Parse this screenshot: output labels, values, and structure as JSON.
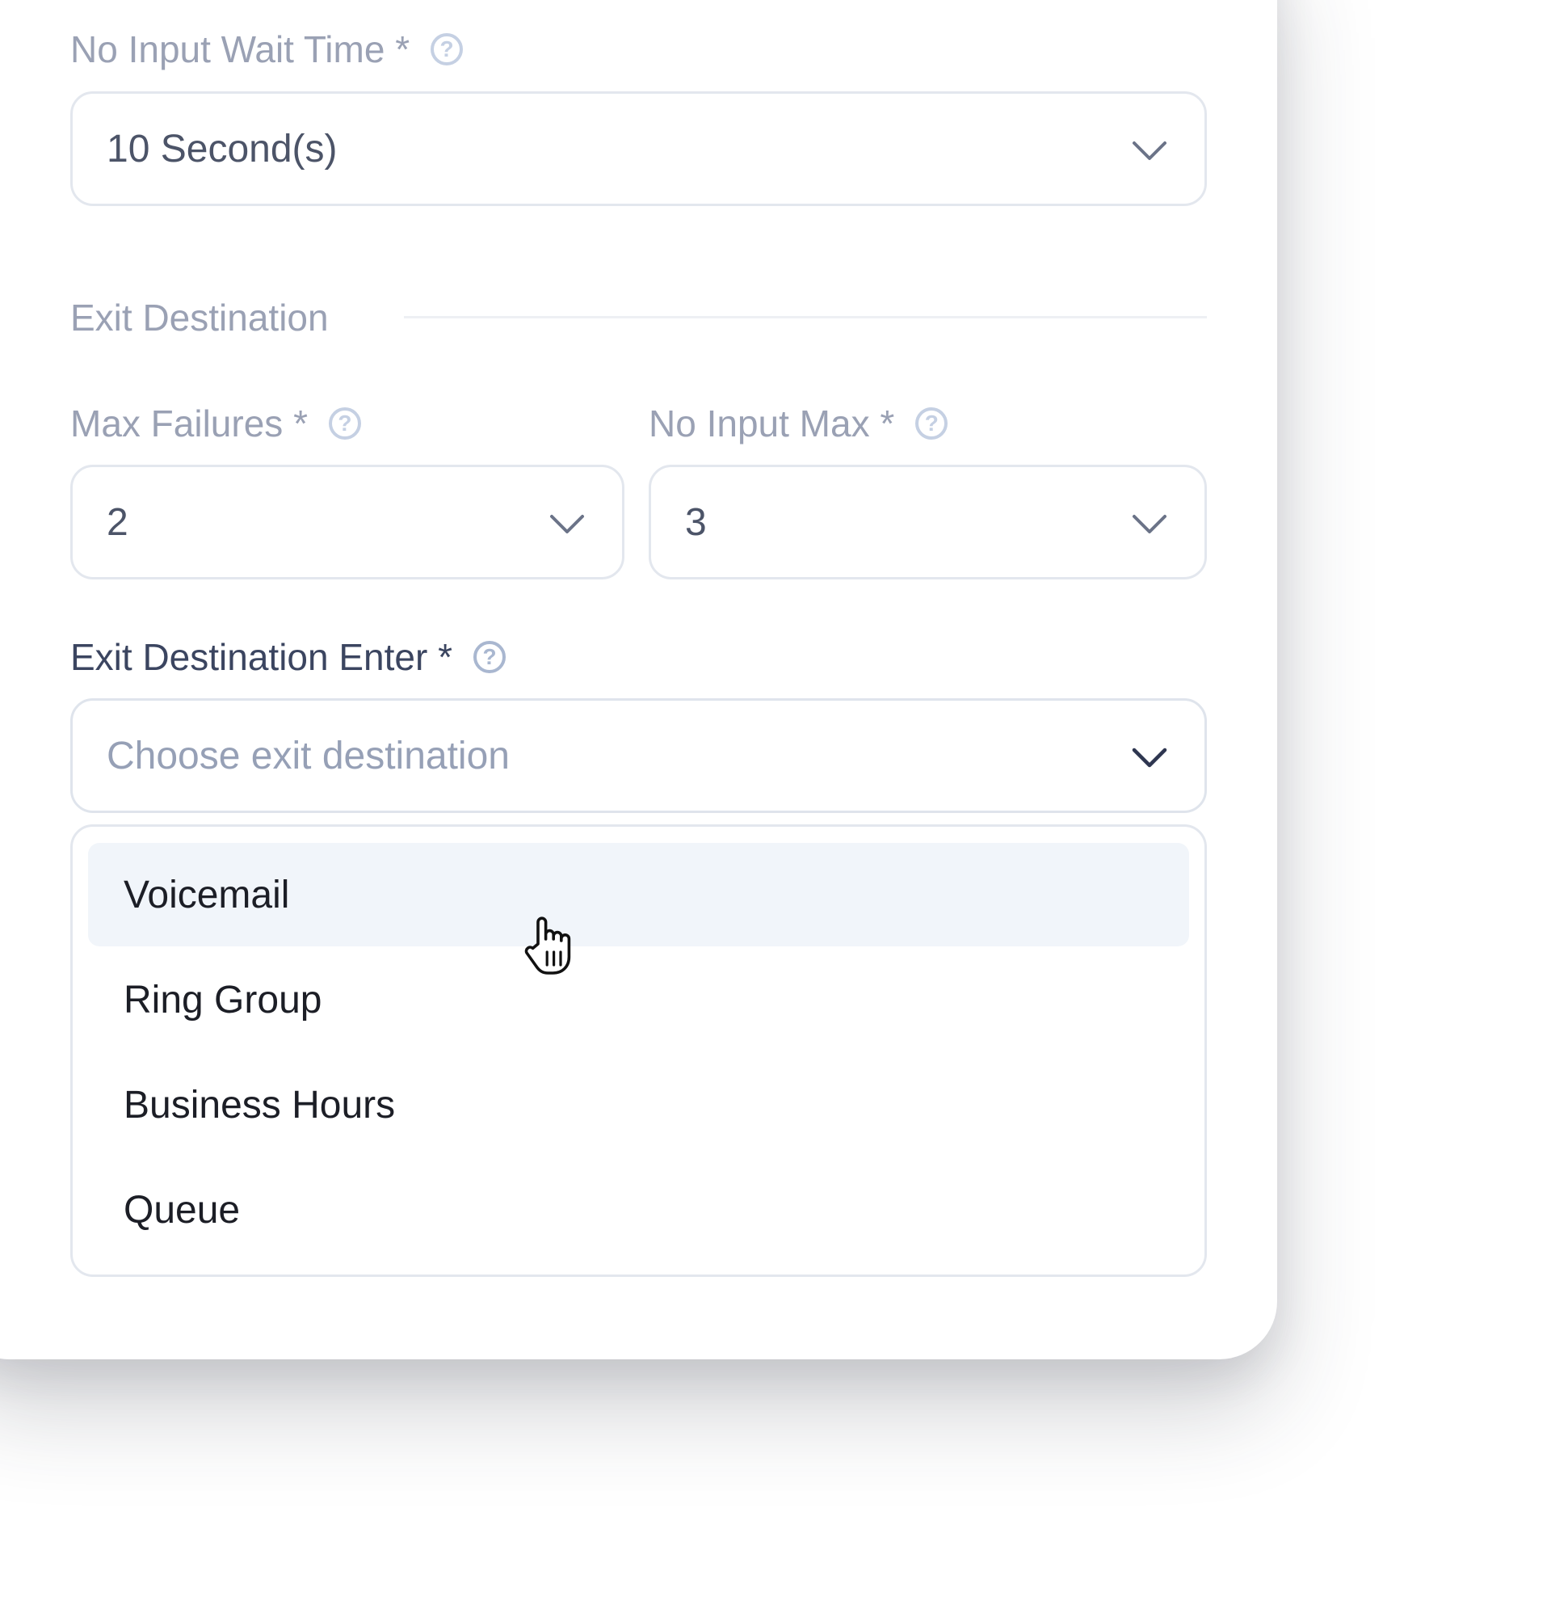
{
  "form": {
    "no_input_wait": {
      "label": "No Input Wait Time *",
      "value": "10 Second(s)"
    },
    "exit_section_title": "Exit Destination",
    "max_failures": {
      "label": "Max Failures *",
      "value": "2"
    },
    "no_input_max": {
      "label": "No Input Max *",
      "value": "3"
    },
    "exit_destination": {
      "label": "Exit Destination Enter *",
      "placeholder": "Choose exit destination",
      "options": [
        "Voicemail",
        "Ring Group",
        "Business Hours",
        "Queue"
      ],
      "hovered_option": "Voicemail"
    }
  },
  "icons": {
    "help": "?"
  },
  "colors": {
    "label": "#9aa1b4",
    "label_active": "#3b4560",
    "border": "#e3e7ee",
    "hover_bg": "#f1f5fa",
    "placeholder": "#96a0b6",
    "option_text": "#1c1e26"
  }
}
